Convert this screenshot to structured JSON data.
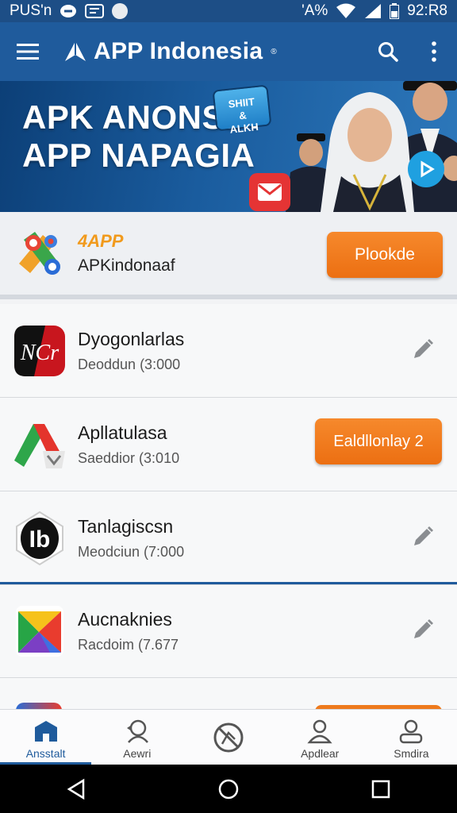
{
  "status_bar": {
    "left_text": "PUS'n",
    "time": "92:R8",
    "network_text": "'A%"
  },
  "app_bar": {
    "title": "APP Indonesia",
    "reg_mark": "®"
  },
  "banner": {
    "line1": "APK ANONSIA",
    "line2": "APP NAPAGIA",
    "badge_line1": "SHIIT",
    "badge_line2": "&",
    "badge_line3": "ALKH"
  },
  "featured": {
    "brand": "4APP",
    "name": "APKindonaaf",
    "button_label": "Plookde"
  },
  "apps": [
    {
      "name": "Dyogonlarlas",
      "subtitle": "Deoddun  (3:000",
      "icon": "ncr-logo-icon",
      "action": "edit",
      "icon_text": "NCr"
    },
    {
      "name": "Apllatulasa",
      "subtitle": "Saeddior  (3:010",
      "icon": "triangle-logo-icon",
      "action": "button",
      "button_label": "Ealdllonlay 2"
    },
    {
      "name": "Tanlagiscsn",
      "subtitle": "Meodciun  (7:000",
      "icon": "ib-logo-icon",
      "action": "edit",
      "icon_text": "Ib"
    },
    {
      "name": "Aucnaknies",
      "subtitle": "Racdoim  (7.677",
      "icon": "play-triangle-logo-icon",
      "action": "edit"
    }
  ],
  "bottom_nav": [
    {
      "label": "Ansstalt",
      "icon": "home-icon",
      "active": true
    },
    {
      "label": "Aewri",
      "icon": "refresh-person-icon",
      "active": false
    },
    {
      "label": "",
      "icon": "blocked-circle-icon",
      "active": false
    },
    {
      "label": "Apdlear",
      "icon": "person-icon",
      "active": false
    },
    {
      "label": "Smdira",
      "icon": "user-icon",
      "active": false
    }
  ],
  "colors": {
    "primary": "#1f5b9c",
    "accent": "#ec6f12",
    "status_bar": "#1d4e86"
  }
}
